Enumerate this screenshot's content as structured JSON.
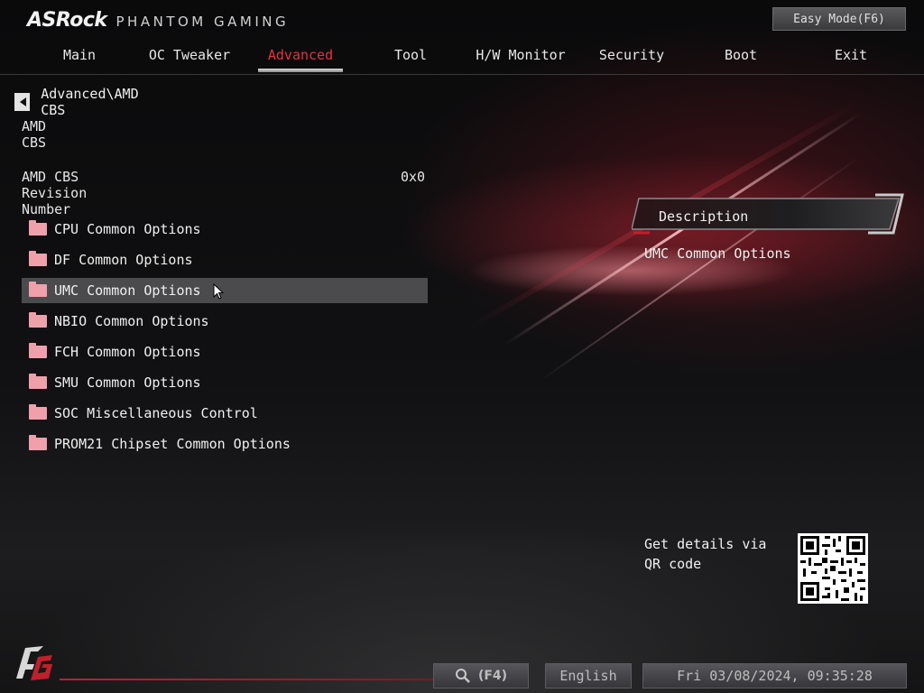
{
  "header": {
    "brand": "ASRock",
    "subtitle": "PHANTOM GAMING",
    "easy_mode_label": "Easy Mode(F6)"
  },
  "nav": {
    "tabs": [
      {
        "label": "Main"
      },
      {
        "label": "OC Tweaker"
      },
      {
        "label": "Advanced",
        "active": true
      },
      {
        "label": "Tool"
      },
      {
        "label": "H/W Monitor"
      },
      {
        "label": "Security"
      },
      {
        "label": "Boot"
      },
      {
        "label": "Exit"
      }
    ]
  },
  "page": {
    "breadcrumb": "Advanced\\AMD CBS",
    "section_title": "AMD CBS",
    "revision_label": "AMD CBS Revision Number",
    "revision_value": "0x0",
    "items": [
      {
        "label": "CPU Common Options"
      },
      {
        "label": "DF Common Options"
      },
      {
        "label": "UMC Common Options",
        "selected": true
      },
      {
        "label": "NBIO Common Options"
      },
      {
        "label": "FCH Common Options"
      },
      {
        "label": "SMU Common Options"
      },
      {
        "label": "SOC Miscellaneous Control"
      },
      {
        "label": "PROM21 Chipset Common Options"
      }
    ]
  },
  "description": {
    "title": "Description",
    "text": "UMC Common Options"
  },
  "qr": {
    "text": "Get details via QR code"
  },
  "footer": {
    "search_key": "(F4)",
    "language": "English",
    "datetime": "Fri 03/08/2024, 09:35:28"
  },
  "colors": {
    "accent_red": "#e8323c",
    "folder_pink": "#f0a0aa",
    "selected_row": "#4b4b4d"
  }
}
